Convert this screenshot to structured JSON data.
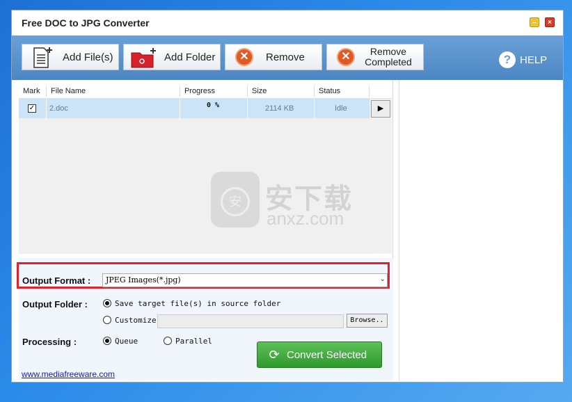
{
  "window": {
    "title": "Free DOC to JPG Converter"
  },
  "toolbar": {
    "add_files": "Add File(s)",
    "add_folder": "Add Folder",
    "remove": "Remove",
    "remove_completed_1": "Remove",
    "remove_completed_2": "Completed",
    "help": "HELP"
  },
  "table": {
    "headers": [
      "Mark",
      "File Name",
      "Progress",
      "Size",
      "Status"
    ],
    "rows": [
      {
        "checked": true,
        "file_name": "2.doc",
        "progress": "0 %",
        "size": "2114 KB",
        "status": "Idle"
      }
    ]
  },
  "watermark": {
    "cn": "安下载",
    "en": "anxz.com",
    "shield_glyph": "安"
  },
  "options": {
    "output_format_label": "Output Format :",
    "output_format_value": "JPEG Images(*.jpg)",
    "output_folder_label": "Output Folder :",
    "save_in_source": "Save target file(s) in source folder",
    "customize": "Customize",
    "browse": "Browse..",
    "processing_label": "Processing :",
    "queue": "Queue",
    "parallel": "Parallel",
    "selected_output_folder": "source",
    "selected_processing": "queue"
  },
  "convert_button": "Convert Selected",
  "website": "www.mediafreeware.com",
  "colors": {
    "highlight": "#e0222a",
    "accent": "#4c86c4",
    "convert": "#2e9a2c"
  }
}
